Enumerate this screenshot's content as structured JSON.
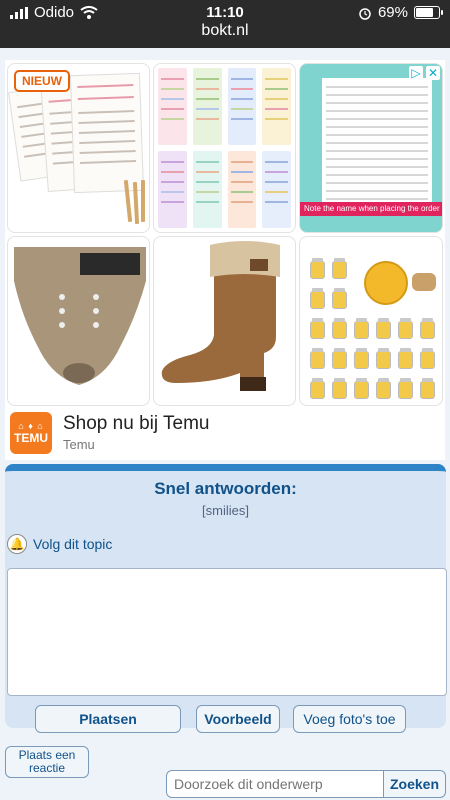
{
  "status_bar": {
    "carrier": "Odido",
    "time": "11:10",
    "battery": "69%",
    "battery_level": 0.69,
    "url": "bokt.nl",
    "icons": [
      "signal-icon",
      "wifi-icon",
      "alarm-icon",
      "battery-icon"
    ]
  },
  "ad": {
    "badge": "NIEUW",
    "tile3_note": "Note the name when placing the order",
    "shop_title": "Shop nu bij Temu",
    "shop_sub": "Temu",
    "logo_text": "TEMU",
    "adchoices_icons": [
      "play-triangle-icon",
      "close-icon"
    ]
  },
  "quick_reply": {
    "title": "Snel antwoorden:",
    "smilies": "[smilies]",
    "follow_label": "Volg dit topic",
    "buttons": {
      "post": "Plaatsen",
      "preview": "Voorbeeld",
      "add_photo": "Voeg foto's toe"
    }
  },
  "bottom": {
    "reply_button": "Plaats een reactie",
    "search_placeholder": "Doorzoek dit onderwerp",
    "search_button": "Zoeken"
  },
  "colors": {
    "accent": "#2f84c7",
    "link": "#105289",
    "panel_bg": "#d7e4f3",
    "temu_orange": "#f47a1f"
  }
}
